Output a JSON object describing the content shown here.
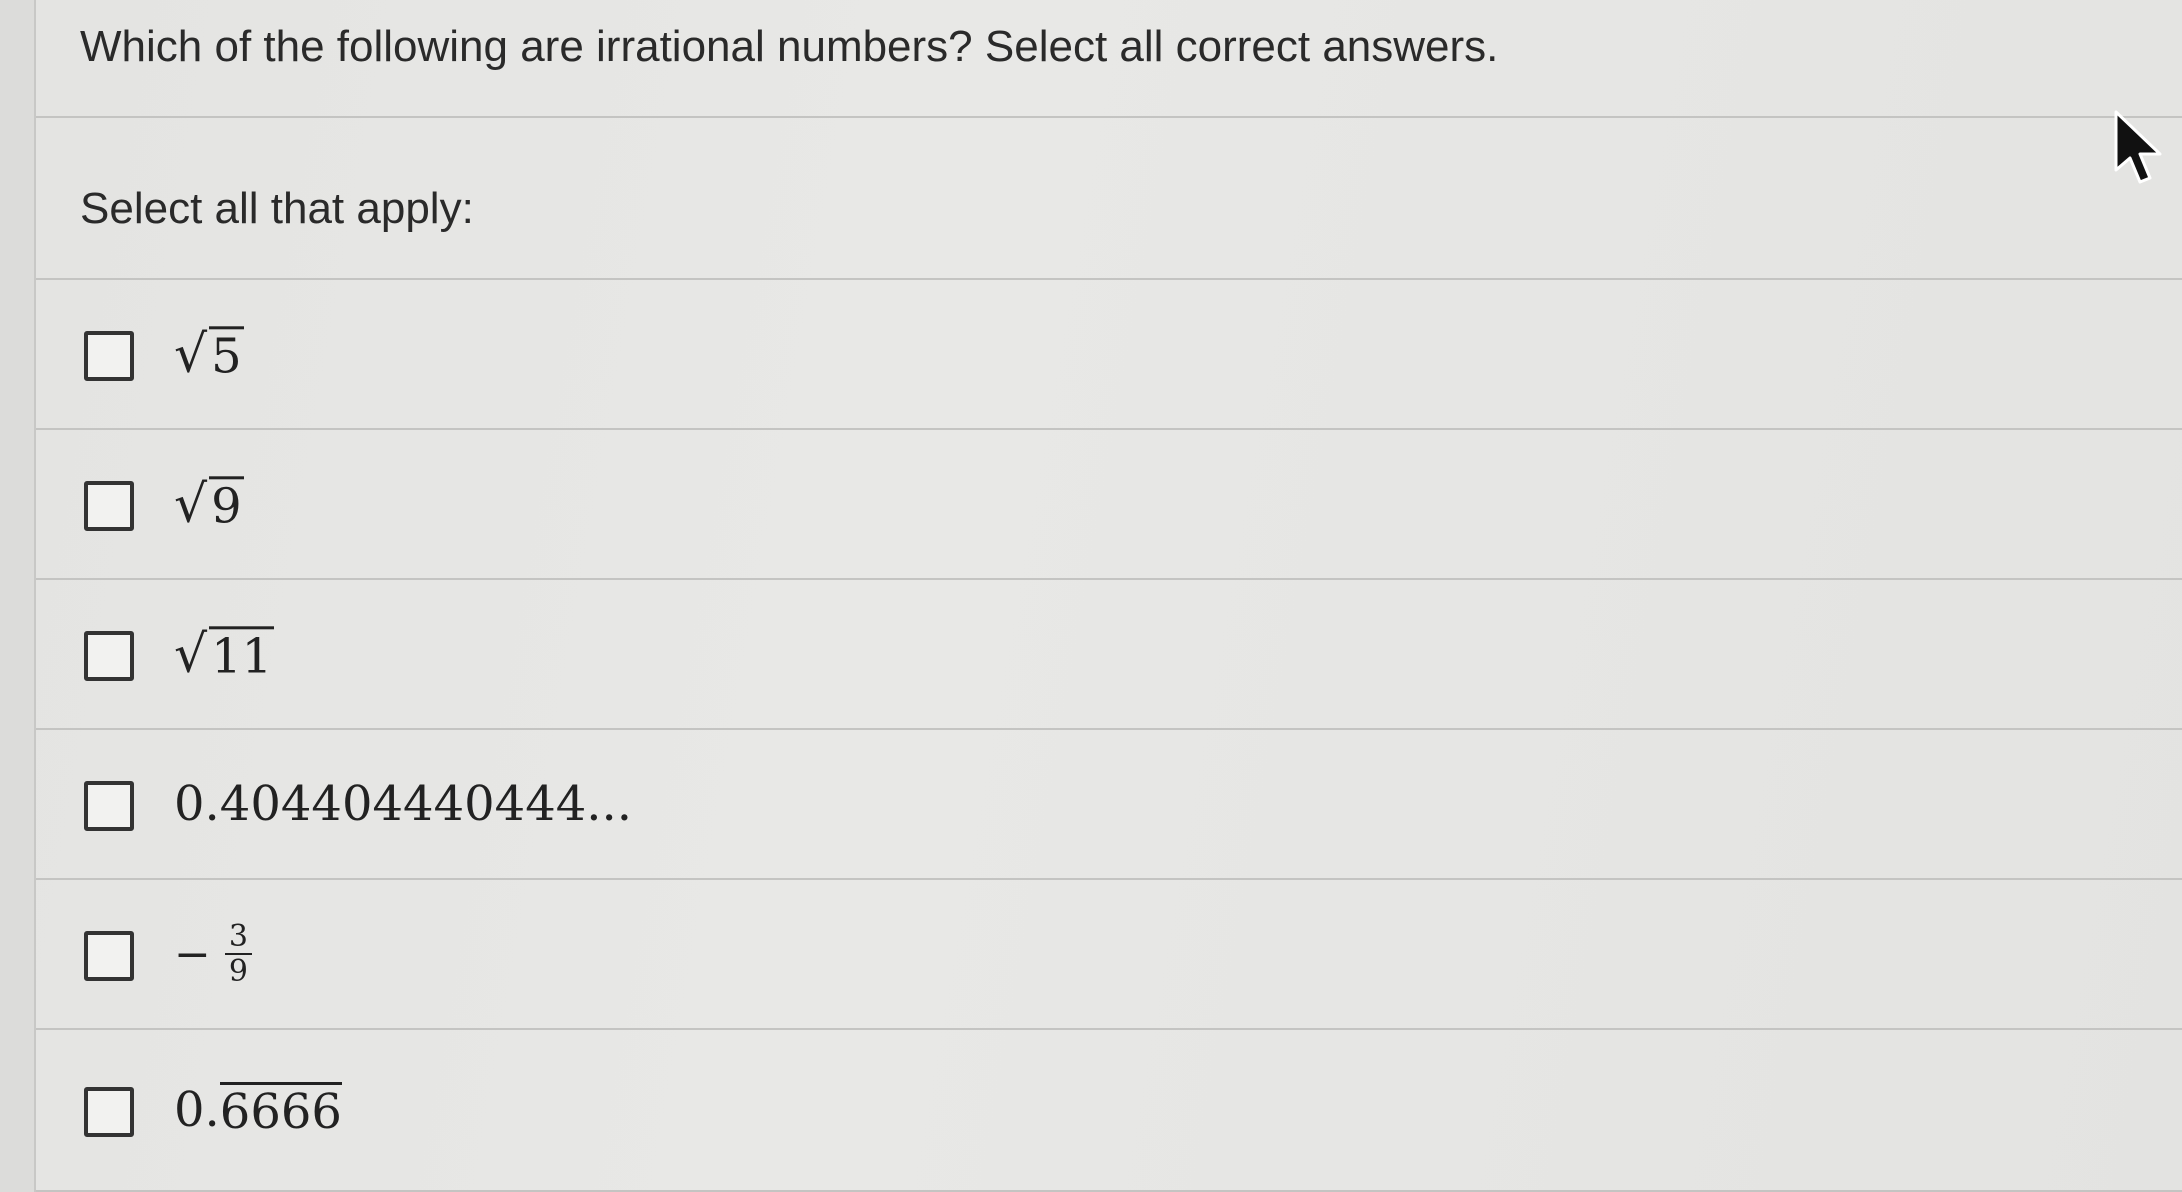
{
  "question": {
    "text": "Which of the following are irrational numbers? Select all correct answers."
  },
  "instruction": {
    "text": "Select all that apply:"
  },
  "options": [
    {
      "radical_symbol": "√",
      "radicand": "5"
    },
    {
      "radical_symbol": "√",
      "radicand": "9"
    },
    {
      "radical_symbol": "√",
      "radicand": "11"
    },
    {
      "text": "0.404404440444..."
    },
    {
      "sign": "−",
      "numerator": "3",
      "denominator": "9"
    },
    {
      "prefix": "0.",
      "repeating": "6666"
    }
  ],
  "colors": {
    "background": "#e6e6e4",
    "divider": "#c4c4c2",
    "text": "#2a2a2a",
    "checkbox_border": "#333333"
  },
  "icons": {
    "cursor": "mouse-pointer-icon",
    "checkbox": "checkbox-unchecked-icon"
  }
}
